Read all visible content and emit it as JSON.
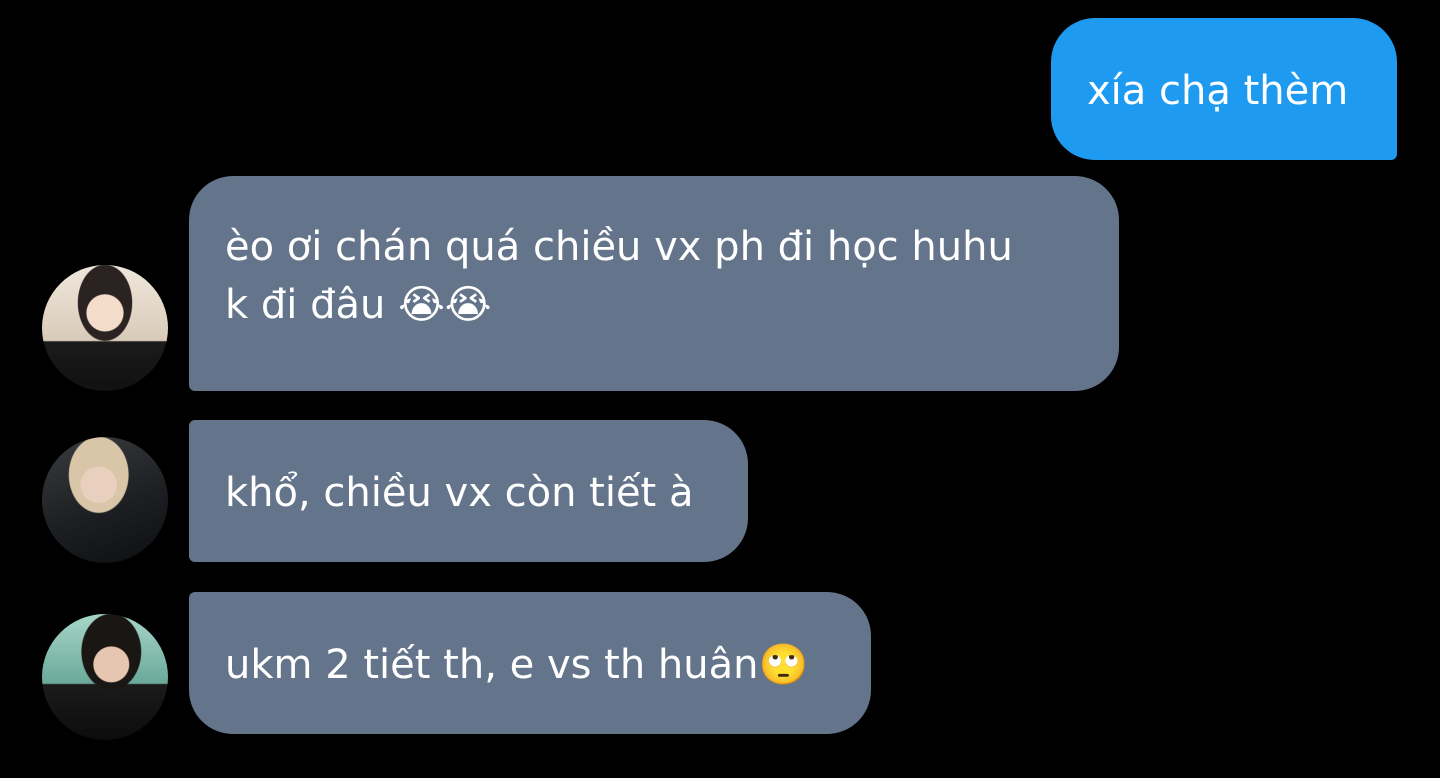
{
  "messages": [
    {
      "direction": "outgoing",
      "lines": [
        "xía chạ thèm"
      ]
    },
    {
      "direction": "incoming",
      "lines": [
        "èo ơi chán quá chiều vx ph đi học huhu",
        "k đi đâu 😭😭"
      ]
    },
    {
      "direction": "incoming",
      "lines": [
        "khổ, chiều vx còn tiết à"
      ]
    },
    {
      "direction": "incoming",
      "lines": [
        "ukm 2 tiết th, e vs th huân🙄"
      ]
    }
  ],
  "colors": {
    "background": "#000000",
    "outgoing_bubble": "#1e9bf0",
    "incoming_bubble": "#64748a",
    "text": "#ffffff"
  }
}
